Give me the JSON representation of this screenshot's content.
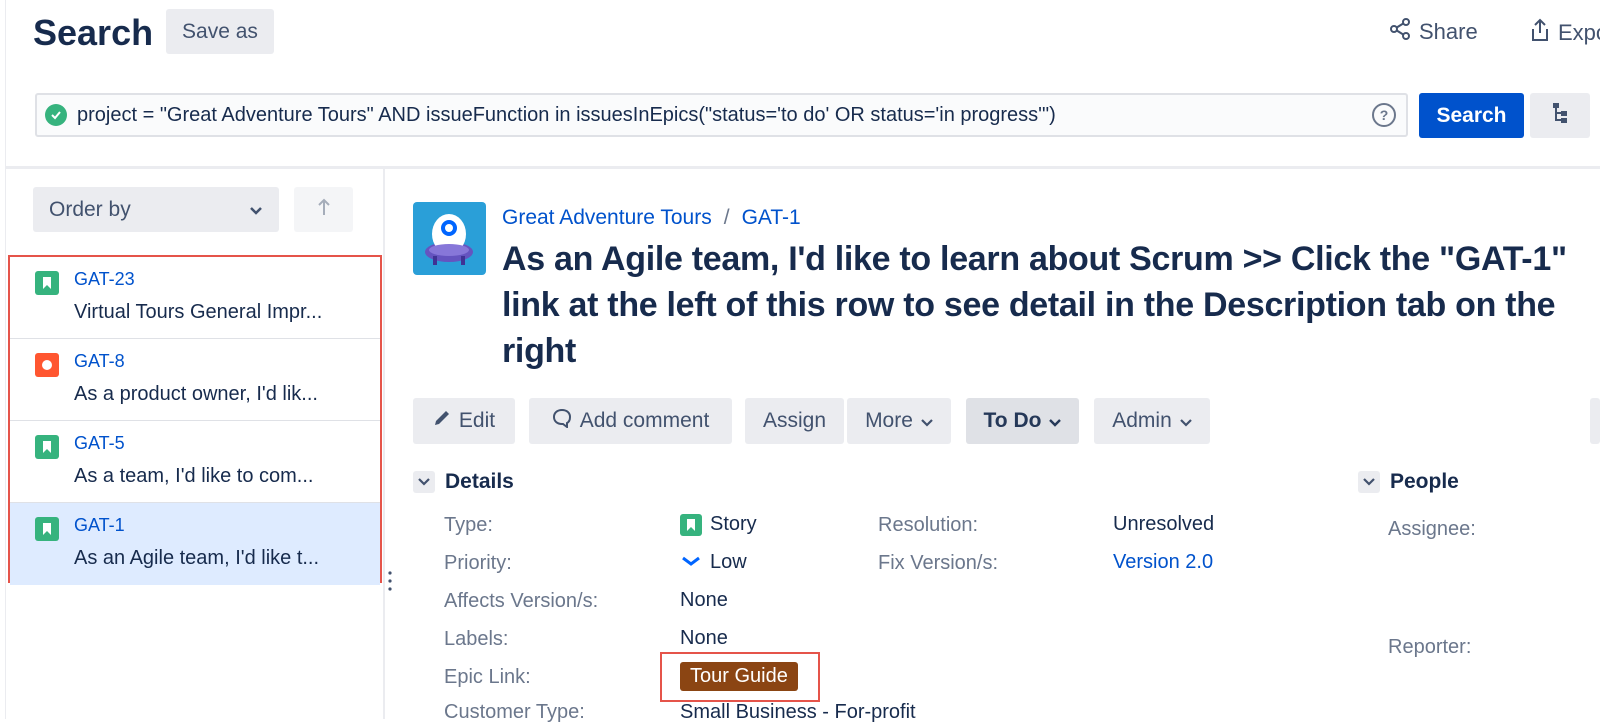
{
  "header": {
    "title": "Search",
    "save_as": "Save as",
    "share": "Share",
    "export": "Expo"
  },
  "jql": {
    "query": "project = \"Great Adventure Tours\" AND issueFunction in issuesInEpics(\"status='to do' OR status='in progress'\")",
    "search_label": "Search"
  },
  "sidebar": {
    "order_by": "Order by",
    "issues": [
      {
        "key": "GAT-23",
        "summary": "Virtual Tours General Impr...",
        "type": "story"
      },
      {
        "key": "GAT-8",
        "summary": "As a product owner, I'd lik...",
        "type": "bug"
      },
      {
        "key": "GAT-5",
        "summary": "As a team, I'd like to com...",
        "type": "story"
      },
      {
        "key": "GAT-1",
        "summary": "As an Agile team, I'd like t...",
        "type": "story"
      }
    ]
  },
  "issue": {
    "project": "Great Adventure Tours",
    "separator": "/",
    "key": "GAT-1",
    "summary": "As an Agile team, I'd like to learn about Scrum >> Click the \"GAT-1\" link at the left of this row to see detail in the Description tab on the right"
  },
  "toolbar": {
    "edit": "Edit",
    "add_comment": "Add comment",
    "assign": "Assign",
    "more": "More",
    "status": "To Do",
    "admin": "Admin"
  },
  "details": {
    "heading": "Details",
    "type_label": "Type:",
    "type_value": "Story",
    "priority_label": "Priority:",
    "priority_value": "Low",
    "affects_label": "Affects Version/s:",
    "affects_value": "None",
    "labels_label": "Labels:",
    "labels_value": "None",
    "epic_label": "Epic Link:",
    "epic_value": "Tour Guide",
    "customer_label": "Customer Type:",
    "customer_value": "Small Business - For-profit",
    "resolution_label": "Resolution:",
    "resolution_value": "Unresolved",
    "fixversion_label": "Fix Version/s:",
    "fixversion_value": "Version 2.0"
  },
  "people": {
    "heading": "People",
    "assignee_label": "Assignee:",
    "reporter_label": "Reporter:"
  },
  "colors": {
    "primary": "#0052cc",
    "story": "#36b37e",
    "bug": "#ff5630",
    "epic": "#8b4513",
    "highlight": "#e5544a"
  }
}
